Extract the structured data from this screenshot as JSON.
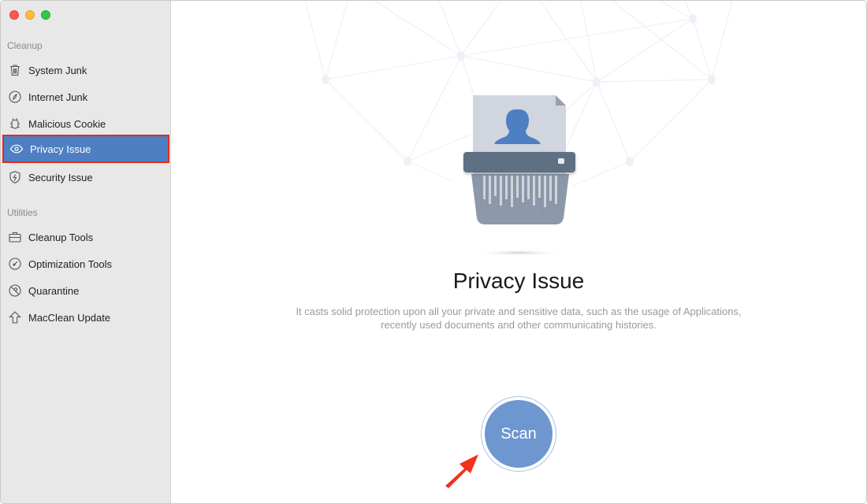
{
  "window": {
    "traffic_lights": [
      "close",
      "minimize",
      "maximize"
    ]
  },
  "sidebar": {
    "sections": [
      {
        "label": "Cleanup",
        "items": [
          {
            "label": "System Junk",
            "icon": "trash-icon"
          },
          {
            "label": "Internet Junk",
            "icon": "compass-leaf-icon"
          },
          {
            "label": "Malicious Cookie",
            "icon": "bug-icon"
          },
          {
            "label": "Privacy Issue",
            "icon": "eye-icon",
            "active": true
          },
          {
            "label": "Security Issue",
            "icon": "shield-bolt-icon"
          }
        ]
      },
      {
        "label": "Utilities",
        "items": [
          {
            "label": "Cleanup Tools",
            "icon": "toolbox-icon"
          },
          {
            "label": "Optimization Tools",
            "icon": "gauge-icon"
          },
          {
            "label": "Quarantine",
            "icon": "quarantine-icon"
          },
          {
            "label": "MacClean Update",
            "icon": "arrow-up-icon"
          }
        ]
      }
    ]
  },
  "main": {
    "title": "Privacy Issue",
    "description_line1": "It casts solid protection upon all your private and sensitive data, such as the usage of Applications,",
    "description_line2": "recently used documents and other communicating histories.",
    "scan_label": "Scan"
  },
  "colors": {
    "accent": "#4e7fc2",
    "scan_button": "#6e97cf",
    "highlight_border": "#e8291b",
    "annotation_arrow": "#f0321c"
  }
}
